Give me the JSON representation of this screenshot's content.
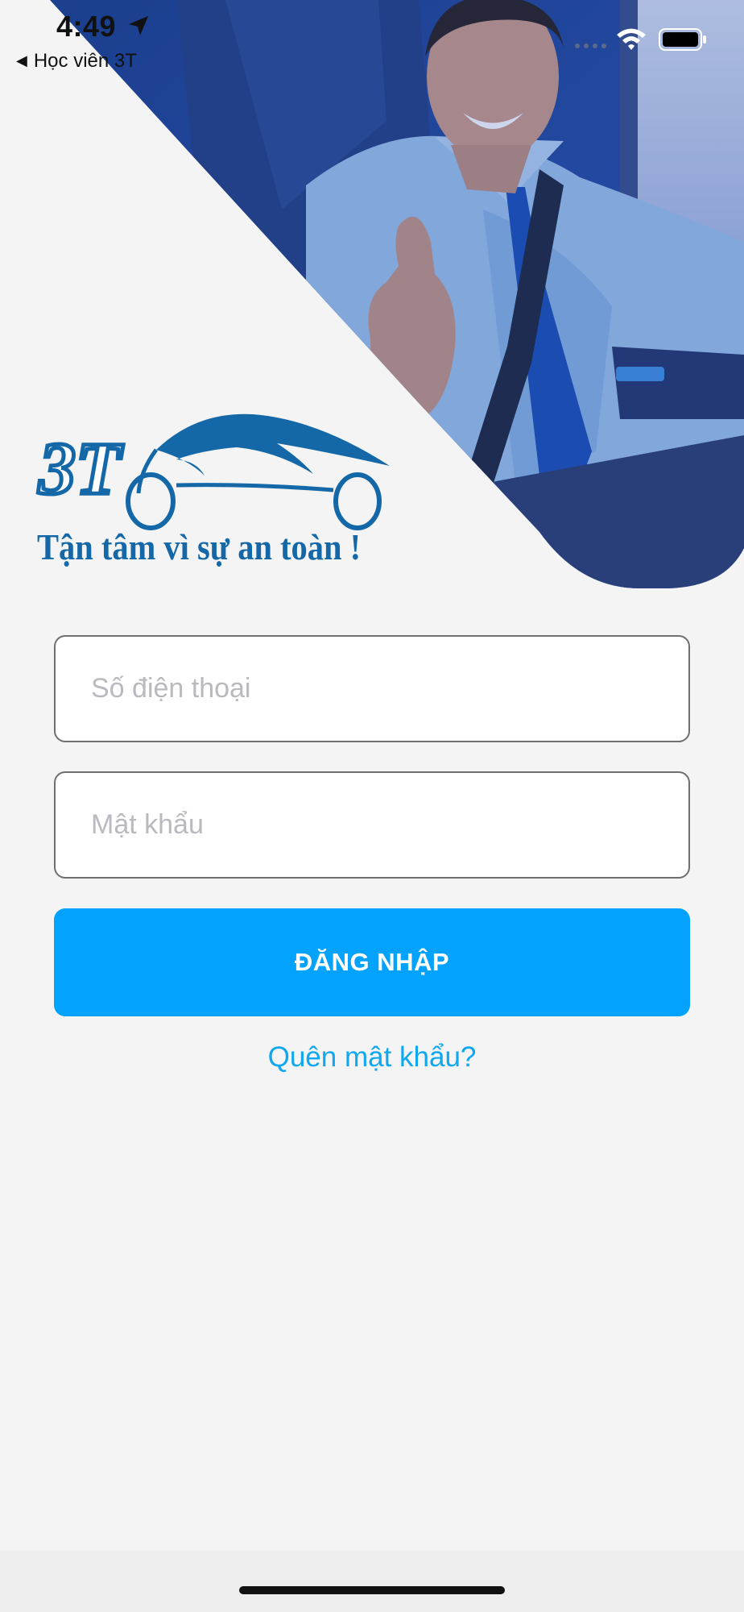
{
  "status_bar": {
    "time": "4:49",
    "back_app": "Học viên 3T",
    "icons": [
      "location-arrow-icon",
      "signal-icon",
      "wifi-icon",
      "battery-icon"
    ]
  },
  "logo": {
    "brand": "3T",
    "tagline": "Tận tâm vì sự an toàn !"
  },
  "form": {
    "phone_placeholder": "Số điện thoại",
    "phone_value": "",
    "password_placeholder": "Mật khẩu",
    "password_value": "",
    "login_label": "ĐĂNG NHẬP",
    "forgot_label": "Quên mật khẩu?"
  },
  "colors": {
    "accent": "#03a2fc",
    "link": "#0ea7f0",
    "brand_blue": "#1568a8",
    "background": "#f4f4f4"
  }
}
